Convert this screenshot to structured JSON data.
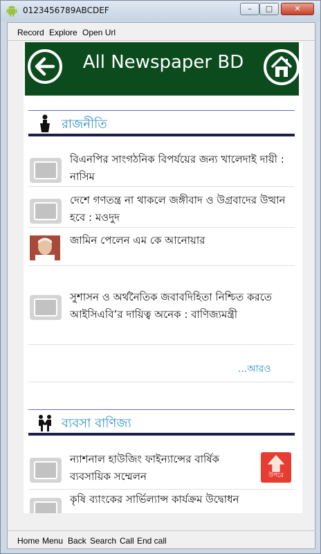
{
  "window": {
    "title": "0123456789ABCDEF",
    "minimize": "–",
    "maximize": "□",
    "close": "✕"
  },
  "menubar": {
    "record": "Record",
    "explore": "Explore",
    "open_url": "Open Url"
  },
  "bottombar": {
    "home": "Home",
    "menu": "Menu",
    "back": "Back",
    "search": "Search",
    "call": "Call",
    "end_call": "End call"
  },
  "header": {
    "title": "All Newspaper BD"
  },
  "sections": [
    {
      "title": "রাজনীতি",
      "items": [
        {
          "text": "বিএনপির সাংগঠনিক বিপর্যয়ের জন্য খালেদাই দায়ী : নাসিম"
        },
        {
          "text": "দেশে গণতন্ত্র না থাকলে জঙ্গীবাদ ও উগ্রবাদের উত্থান হবে : মওদুদ"
        },
        {
          "text": "জামিন পেলেন এম কে আনোয়ার"
        },
        {
          "text": "সুশাসন ও অর্থনৈতিক জবাবদিহিতা নিশ্চিত করতে আইসিএবি’র দায়িত্ব অনেক : বাণিজ্যমন্ত্রী"
        }
      ],
      "more": "...আরও"
    },
    {
      "title": "ব্যবসা বাণিজ্য",
      "items": [
        {
          "text": "ন্যাশনাল হাউজিং ফাইন্যান্সের বার্ষিক ব্যবসায়িক সম্মেলন"
        },
        {
          "text": "কৃষি ব্যাংকের সার্ভিল্যান্স কার্যক্রম উদ্বোধন"
        }
      ]
    }
  ],
  "scroll_top": {
    "label": "উপরে"
  },
  "colors": {
    "header_bg": "#0c4b1d",
    "accent_blue": "#2b8fc6",
    "top_button": "#e53d32"
  }
}
